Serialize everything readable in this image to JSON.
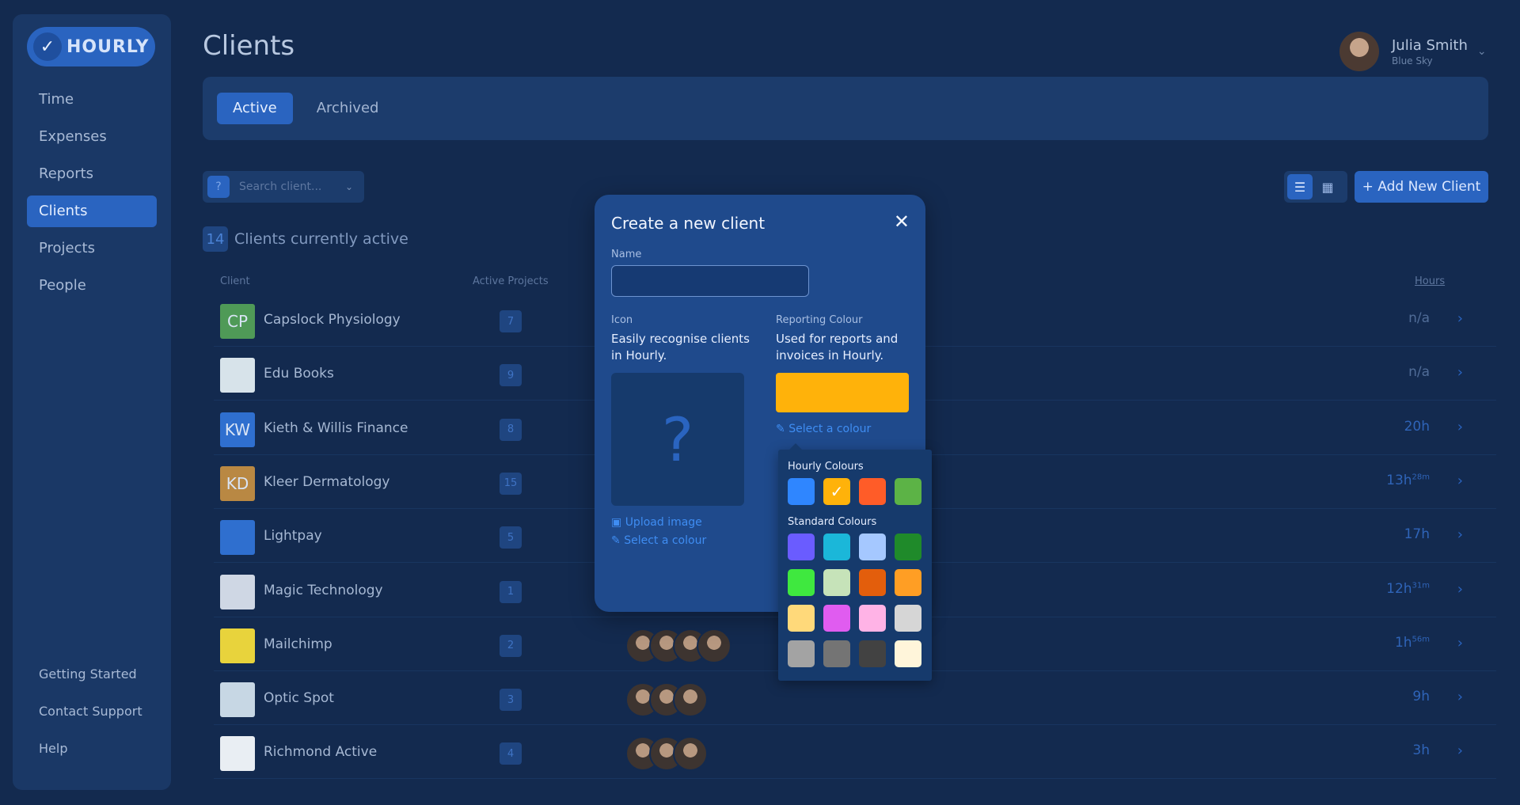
{
  "app": {
    "logo_text": "HOURLY"
  },
  "nav": {
    "items": [
      {
        "label": "Time"
      },
      {
        "label": "Expenses"
      },
      {
        "label": "Reports"
      },
      {
        "label": "Clients"
      },
      {
        "label": "Projects"
      },
      {
        "label": "People"
      }
    ],
    "bottom": [
      {
        "label": "Getting Started"
      },
      {
        "label": "Contact Support"
      },
      {
        "label": "Help"
      }
    ],
    "active": "Clients"
  },
  "header": {
    "title": "Clients",
    "user_name": "Julia Smith",
    "user_org": "Blue Sky"
  },
  "tabs": [
    {
      "label": "Active"
    },
    {
      "label": "Archived"
    }
  ],
  "toolbar": {
    "search_placeholder": "Search client...",
    "search_icon": "?",
    "add_label": "+ Add New Client"
  },
  "summary": {
    "count": "14",
    "label": "Clients currently active"
  },
  "table": {
    "columns": {
      "client": "Client",
      "projects": "Active Projects",
      "hours": "Hours"
    },
    "rows": [
      {
        "name": "Capslock Physiology",
        "initials": "CP",
        "icon_color": "#4f9a57",
        "projects": "7",
        "people": 0,
        "hours": "n/a",
        "hours_sup": ""
      },
      {
        "name": "Edu Books",
        "initials": "",
        "icon_color": "#d7e3ea",
        "projects": "9",
        "people": 0,
        "hours": "n/a",
        "hours_sup": ""
      },
      {
        "name": "Kieth & Willis Finance",
        "initials": "KW",
        "icon_color": "#2f6fcf",
        "projects": "8",
        "people": 0,
        "hours": "20h",
        "hours_sup": ""
      },
      {
        "name": "Kleer Dermatology",
        "initials": "KD",
        "icon_color": "#b98843",
        "projects": "15",
        "people": 0,
        "hours": "13h",
        "hours_sup": "28m"
      },
      {
        "name": "Lightpay",
        "initials": "",
        "icon_color": "#2f6fcf",
        "projects": "5",
        "people": 0,
        "hours": "17h",
        "hours_sup": ""
      },
      {
        "name": "Magic Technology",
        "initials": "",
        "icon_color": "#cfd7e4",
        "projects": "1",
        "people": 0,
        "hours": "12h",
        "hours_sup": "31m"
      },
      {
        "name": "Mailchimp",
        "initials": "",
        "icon_color": "#e8d33c",
        "projects": "2",
        "people": 4,
        "hours": "1h",
        "hours_sup": "56m"
      },
      {
        "name": "Optic Spot",
        "initials": "",
        "icon_color": "#c7d7e4",
        "projects": "3",
        "people": 3,
        "hours": "9h",
        "hours_sup": ""
      },
      {
        "name": "Richmond Active",
        "initials": "",
        "icon_color": "#e9eef3",
        "projects": "4",
        "people": 3,
        "hours": "3h",
        "hours_sup": ""
      }
    ]
  },
  "modal": {
    "title": "Create a new client",
    "name_label": "Name",
    "name_value": "",
    "icon_label": "Icon",
    "icon_desc": "Easily recognise clients in Hourly.",
    "upload_link": "Upload image",
    "icon_color_link": "Select a colour",
    "color_label": "Reporting Colour",
    "color_desc": "Used for reports and invoices in Hourly.",
    "color_link": "Select a colour",
    "selected_color": "#ffb20a"
  },
  "palette": {
    "hourly_title": "Hourly Colours",
    "standard_title": "Standard Colours",
    "hourly": [
      "#2f86ff",
      "#ffb20a",
      "#ff5c28",
      "#5cb346"
    ],
    "hourly_selected_index": 1,
    "standard": [
      "#6a5cff",
      "#1bb7d9",
      "#a5c8ff",
      "#1f8a2a",
      "#3fe83f",
      "#c6e3b9",
      "#e35e0c",
      "#ff9e24",
      "#ffd97a",
      "#e05cf0",
      "#ffb3e6",
      "#d6d6d6",
      "#a3a3a3",
      "#747474",
      "#424242",
      "#fff5da"
    ]
  }
}
